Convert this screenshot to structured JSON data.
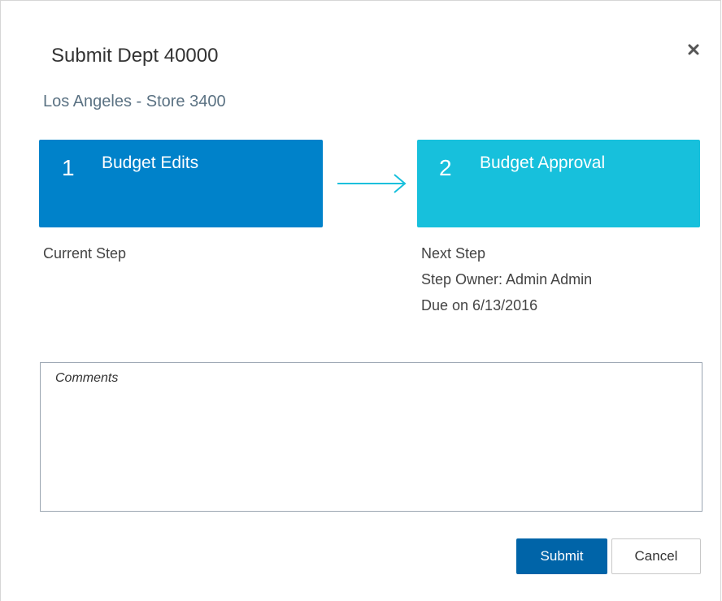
{
  "dialog": {
    "title": "Submit Dept 40000",
    "subtitle": "Los Angeles - Store 3400",
    "close_icon": "close-icon"
  },
  "steps": {
    "current": {
      "number": "1",
      "name": "Budget Edits",
      "label": "Current Step",
      "color": "#0082ca"
    },
    "next": {
      "number": "2",
      "name": "Budget Approval",
      "label": "Next Step",
      "owner": "Step Owner: Admin Admin",
      "due": "Due on 6/13/2016",
      "color": "#17c0dc"
    },
    "arrow_icon": "arrow-right-icon"
  },
  "comments": {
    "placeholder": "Comments",
    "value": ""
  },
  "buttons": {
    "submit_label": "Submit",
    "cancel_label": "Cancel",
    "submit_color": "#0064a8"
  }
}
